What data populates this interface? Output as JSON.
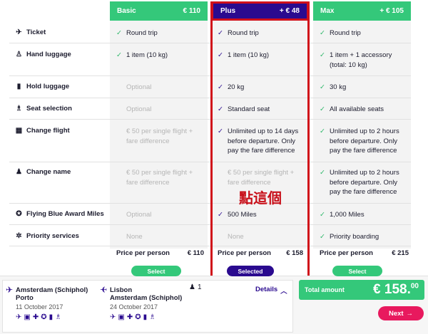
{
  "plans": {
    "basic": {
      "name": "Basic",
      "price": "€ 110",
      "price_label": "Price per person",
      "price_value": "€ 110",
      "select_label": "Select"
    },
    "plus": {
      "name": "Plus",
      "price": "+ € 48",
      "price_label": "Price per person",
      "price_value": "€ 158",
      "select_label": "Selected"
    },
    "max": {
      "name": "Max",
      "price": "+ € 105",
      "price_label": "Price per person",
      "price_value": "€ 215",
      "select_label": "Select"
    }
  },
  "rows": [
    {
      "label": "Ticket",
      "icon": "plane-icon",
      "basic": "Round trip",
      "plus": "Round trip",
      "max": "Round trip"
    },
    {
      "label": "Hand luggage",
      "icon": "hand-luggage-icon",
      "basic": "1 item (10 kg)",
      "plus": "1 item (10 kg)",
      "max": "1 item + 1 accessory (total: 10 kg)"
    },
    {
      "label": "Hold luggage",
      "icon": "hold-luggage-icon",
      "basic": "Optional",
      "plus": "20 kg",
      "max": "30 kg"
    },
    {
      "label": "Seat selection",
      "icon": "seat-icon",
      "basic": "Optional",
      "plus": "Standard seat",
      "max": "All available seats"
    },
    {
      "label": "Change flight",
      "icon": "calendar-icon",
      "basic": "€ 50 per single flight + fare difference",
      "plus": "Unlimited up to 14 days before departure. Only pay the fare difference",
      "max": "Unlimited up to 2 hours before departure. Only pay the fare difference"
    },
    {
      "label": "Change name",
      "icon": "person-icon",
      "basic": "€ 50 per single flight + fare difference",
      "plus": "€ 50 per single flight + fare difference",
      "max": "Unlimited up to 2 hours before departure. Only pay the fare difference"
    },
    {
      "label": "Flying Blue Award Miles",
      "icon": "award-icon",
      "basic": "Optional",
      "plus": "500 Miles",
      "max": "1,000 Miles"
    },
    {
      "label": "Priority services",
      "icon": "priority-icon",
      "basic": "None",
      "plus": "None",
      "max": "Priority boarding"
    }
  ],
  "overlay_text": "點這個",
  "itinerary": {
    "outbound": {
      "from": "Amsterdam (Schiphol)",
      "to": "Porto",
      "date": "11 October 2017"
    },
    "inbound": {
      "from": "Lisbon",
      "to": "Amsterdam (Schiphol)",
      "date": "24 October 2017"
    },
    "passengers": "1",
    "details_label": "Details"
  },
  "total": {
    "label": "Total amount",
    "amount": "€ 158.",
    "cents": "00"
  },
  "next_label": "Next",
  "colors": {
    "green": "#34c87a",
    "indigo": "#2a0a8f",
    "red": "#d0101a",
    "pink": "#e8195e"
  }
}
